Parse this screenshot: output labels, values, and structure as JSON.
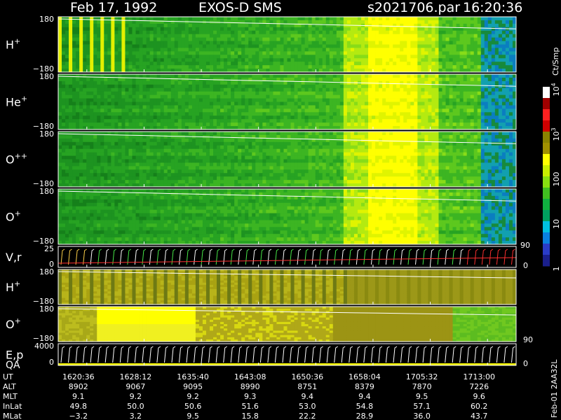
{
  "header": {
    "date": "Feb 17, 1992",
    "instrument": "EXOS-D SMS",
    "file": "s2021706.par",
    "time": "16:20:36"
  },
  "side_label": "Feb-01 2AA32L",
  "chart_data": {
    "type": "heatmap",
    "x_ticks": [
      "1620:36",
      "1628:12",
      "1635:40",
      "1643:08",
      "1650:36",
      "1658:04",
      "1705:32",
      "1713:00"
    ],
    "panels": [
      {
        "label": "H",
        "sup": "+",
        "ymax": "180",
        "ymin": "−180",
        "kind": "spectro",
        "profile": "main"
      },
      {
        "label": "He",
        "sup": "+",
        "ymax": "180",
        "ymin": "−180",
        "kind": "spectro",
        "profile": "main"
      },
      {
        "label": "O",
        "sup": "++",
        "ymax": "180",
        "ymin": "−180",
        "kind": "spectro",
        "profile": "main"
      },
      {
        "label": "O",
        "sup": "+",
        "ymax": "180",
        "ymin": "−180",
        "kind": "spectro",
        "profile": "main"
      },
      {
        "label": "V,r",
        "sup": "",
        "ymax": "25",
        "ymin": "0",
        "right_max": "90",
        "right_min": "0",
        "kind": "ticks"
      },
      {
        "label": "H",
        "sup": "+",
        "ymax": "180",
        "ymin": "−180",
        "kind": "spectro",
        "profile": "stripe"
      },
      {
        "label": "O",
        "sup": "+",
        "ymax": "180",
        "ymin": "−180",
        "right_min": "90",
        "kind": "spectro",
        "profile": "olive"
      },
      {
        "label": "E,p",
        "label2": "QA",
        "sup": "",
        "ymax": "4000",
        "ymin": "0",
        "right_min": "0",
        "kind": "ticks2"
      }
    ],
    "colorbar": {
      "unit": "Ct/Smp",
      "labels": [
        {
          "text": "1",
          "frac": 0.0
        },
        {
          "text": "10",
          "frac": 0.25
        },
        {
          "text": "100",
          "frac": 0.5
        },
        {
          "text": "10",
          "sup": "3",
          "frac": 0.75
        },
        {
          "text": "10",
          "sup": "4",
          "frac": 1.0
        }
      ],
      "colors": [
        "#1a1f8c",
        "#2a3cc8",
        "#0a80e0",
        "#00c0e0",
        "#00a060",
        "#10b040",
        "#40c020",
        "#88e010",
        "#c8ee00",
        "#ffff00",
        "#a09000",
        "#8a8200",
        "#d00000",
        "#ff2020",
        "#a00000",
        "#ffffff"
      ]
    },
    "table": {
      "rows": [
        {
          "label": "UT",
          "values": [
            "1620:36",
            "1628:12",
            "1635:40",
            "1643:08",
            "1650:36",
            "1658:04",
            "1705:32",
            "1713:00"
          ]
        },
        {
          "label": "ALT",
          "values": [
            "8902",
            "9067",
            "9095",
            "8990",
            "8751",
            "8379",
            "7870",
            "7226"
          ]
        },
        {
          "label": "MLT",
          "values": [
            "9.1",
            "9.2",
            "9.2",
            "9.3",
            "9.4",
            "9.4",
            "9.5",
            "9.6"
          ]
        },
        {
          "label": "InLat",
          "values": [
            "49.8",
            "50.0",
            "50.6",
            "51.6",
            "53.0",
            "54.8",
            "57.1",
            "60.2"
          ]
        },
        {
          "label": "MLat",
          "values": [
            "−3.2",
            "3.2",
            "9.5",
            "15.8",
            "22.2",
            "28.9",
            "36.0",
            "43.7"
          ]
        }
      ]
    }
  }
}
